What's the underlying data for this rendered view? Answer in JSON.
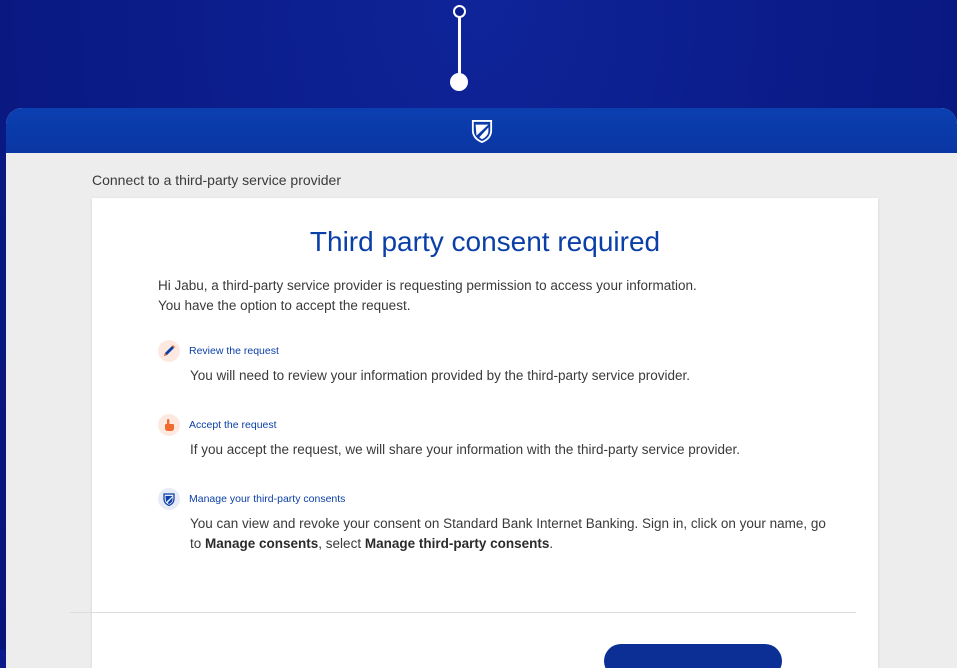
{
  "colors": {
    "backdrop": "#0a1a8a",
    "brand_blue": "#0b3fa8",
    "topbar": "#0a36a3",
    "accent_orange": "#f26a2e"
  },
  "header": {
    "logo_icon": "standard-bank-shield-icon"
  },
  "page": {
    "heading": "Connect to a third-party service provider"
  },
  "card": {
    "title": "Third party consent required",
    "intro_line1": "Hi Jabu, a third-party service provider is requesting permission to access your information.",
    "intro_line2": "You have the option to accept the request.",
    "items": [
      {
        "icon": "pencil-icon",
        "title": "Review the request",
        "description": "You will need to review your information provided by the third-party service provider."
      },
      {
        "icon": "pointing-hand-icon",
        "title": "Accept the request",
        "description": "If you accept the request, we will share your information with the third-party service provider."
      },
      {
        "icon": "standard-bank-shield-icon",
        "title": "Manage your third-party consents",
        "description_part1": "You can view and revoke your consent on Standard Bank Internet Banking. Sign in, click on your name, go to ",
        "description_bold1": "Manage consents",
        "description_part2": ", select ",
        "description_bold2": "Manage third-party consents",
        "description_part3": "."
      }
    ]
  }
}
